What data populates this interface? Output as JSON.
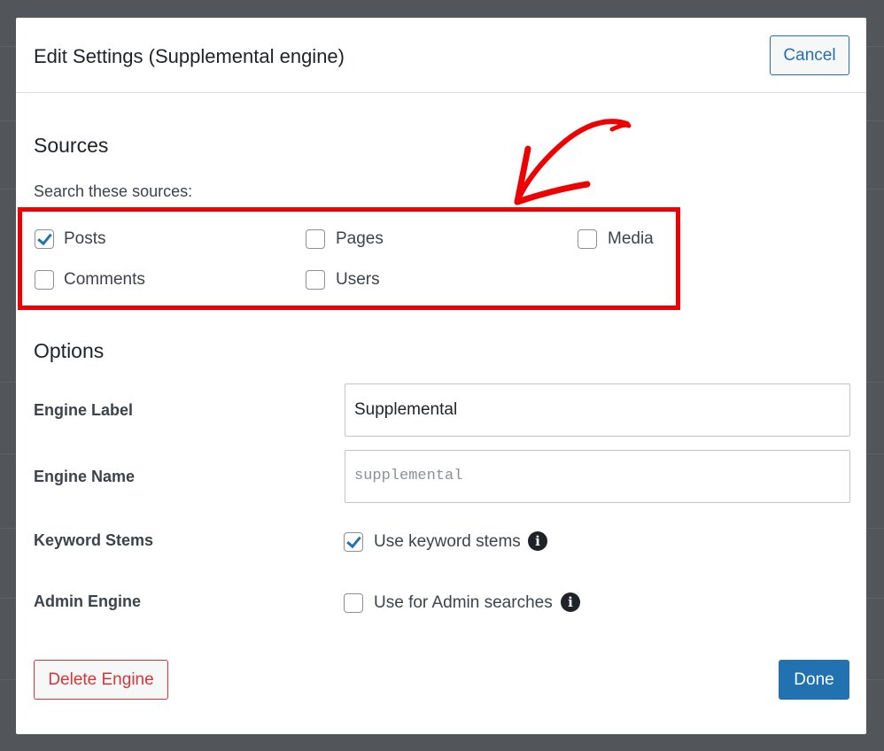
{
  "modal": {
    "title": "Edit Settings (Supplemental engine)",
    "cancel_label": "Cancel"
  },
  "sources": {
    "title": "Sources",
    "subtitle": "Search these sources:",
    "items": [
      {
        "label": "Posts",
        "checked": true
      },
      {
        "label": "Pages",
        "checked": false
      },
      {
        "label": "Media",
        "checked": false
      },
      {
        "label": "Comments",
        "checked": false
      },
      {
        "label": "Users",
        "checked": false
      }
    ]
  },
  "options": {
    "title": "Options",
    "engine_label": {
      "label": "Engine Label",
      "value": "Supplemental"
    },
    "engine_name": {
      "label": "Engine Name",
      "value": "supplemental"
    },
    "keyword_stems": {
      "label": "Keyword Stems",
      "checkbox_label": "Use keyword stems",
      "checked": true
    },
    "admin_engine": {
      "label": "Admin Engine",
      "checkbox_label": "Use for Admin searches",
      "checked": false
    }
  },
  "footer": {
    "delete_label": "Delete Engine",
    "done_label": "Done"
  },
  "annotation": {
    "color": "#ee0000",
    "icon": "red-arrow-icon"
  },
  "colors": {
    "primary": "#2271b1",
    "danger": "#d63638",
    "overlay": "#525559"
  }
}
